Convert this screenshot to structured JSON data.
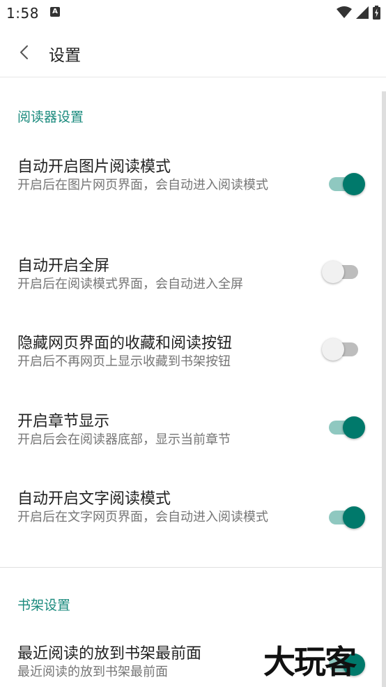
{
  "status_bar": {
    "time": "1:58",
    "notification_icon": "a-notification-icon",
    "icons": [
      "wifi-icon",
      "signal-icon",
      "battery-charging-icon"
    ]
  },
  "header": {
    "back_icon": "chevron-left-icon",
    "title": "设置"
  },
  "sections": [
    {
      "header": "阅读器设置",
      "items": [
        {
          "title": "自动开启图片阅读模式",
          "summary": "开启后在图片网页界面，会自动进入阅读模式",
          "enabled": true
        },
        {
          "title": "自动开启全屏",
          "summary": "开启后在阅读模式界面，会自动进入全屏",
          "enabled": false
        },
        {
          "title": "隐藏网页界面的收藏和阅读按钮",
          "summary": "开启后不再网页上显示收藏到书架按钮",
          "enabled": false
        },
        {
          "title": "开启章节显示",
          "summary": "开启后会在阅读器底部，显示当前章节",
          "enabled": true
        },
        {
          "title": "自动开启文字阅读模式",
          "summary": "开启后在文字网页界面，会自动进入阅读模式",
          "enabled": true
        }
      ]
    },
    {
      "header": "书架设置",
      "items": [
        {
          "title": "最近阅读的放到书架最前面",
          "summary": "最近阅读的放到书架最前面",
          "enabled": true
        }
      ]
    }
  ],
  "watermark": "大玩客",
  "colors": {
    "accent": "#00796b",
    "accent_track": "#8fc8c0",
    "section_header": "#1a8a7d",
    "switch_off_track": "#bdbdbd",
    "switch_off_thumb": "#f1f1f1"
  }
}
